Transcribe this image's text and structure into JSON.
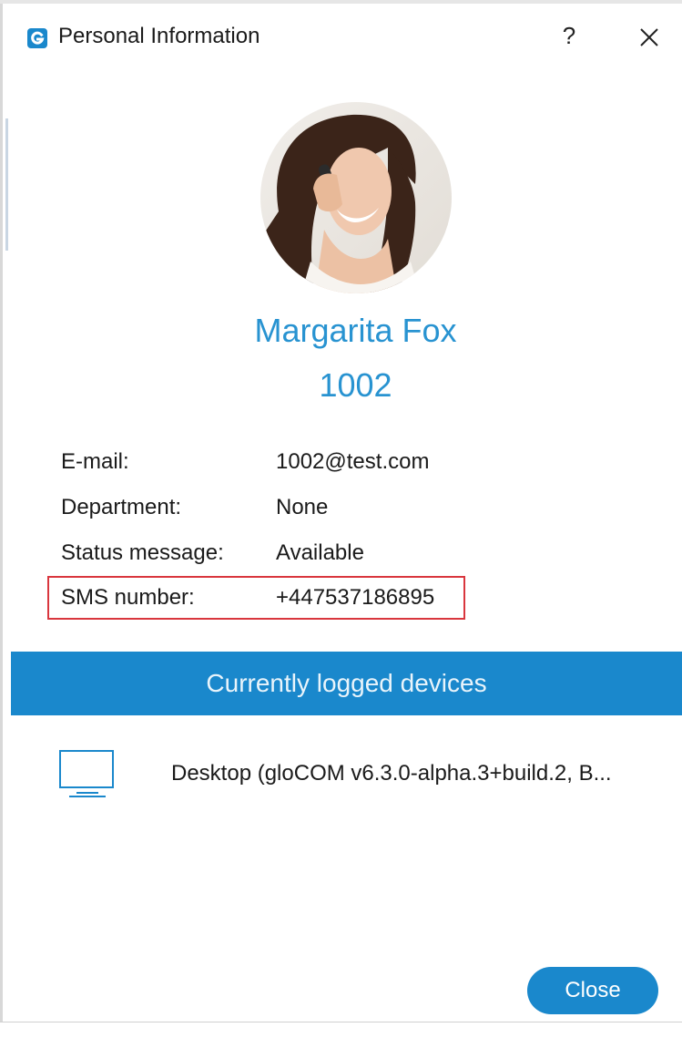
{
  "window": {
    "title": "Personal Information",
    "help_label": "?",
    "app_icon": "gloCOM-logo-icon",
    "close_icon": "close-icon"
  },
  "profile": {
    "name": "Margarita Fox",
    "extension": "1002",
    "avatar": "avatar-photo"
  },
  "info": [
    {
      "label": "E-mail:",
      "value": "1002@test.com"
    },
    {
      "label": "Department:",
      "value": "None"
    },
    {
      "label": "Status message:",
      "value": "Available"
    },
    {
      "label": "SMS number:",
      "value": "+447537186895"
    }
  ],
  "devices": {
    "header": "Currently logged devices",
    "items": [
      {
        "icon": "monitor-icon",
        "label": "Desktop (gloCOM v6.3.0-alpha.3+build.2, B..."
      }
    ]
  },
  "footer": {
    "close_label": "Close"
  },
  "colors": {
    "accent": "#1a88cc",
    "name_text": "#2893d1",
    "highlight": "#d9363e"
  }
}
